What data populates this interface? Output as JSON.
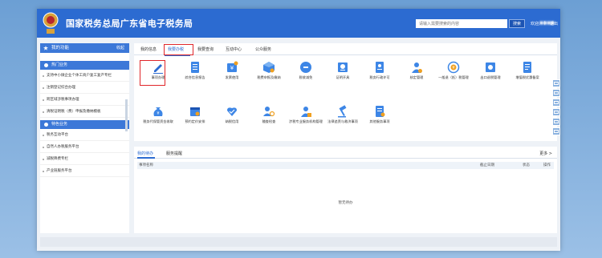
{
  "header": {
    "title": "国家税务总局广东省电子税务局",
    "search_placeholder": "请输入需要搜索的内容",
    "search_button": "搜索",
    "welcome": "欢迎,",
    "username": "■■■■",
    "separator": "|",
    "logout": "退出",
    "brand_color": "#2c6bd1"
  },
  "sidebar": {
    "header": "我的功能",
    "header_right": "收起",
    "sections": [
      {
        "title": "热门业务",
        "items": [
          "支持中小微企业个体工商户复工复产专栏",
          "注销登记综合办理",
          "跨区域涉税事项办理",
          "清税证明税（费）申报及缴纳模板"
        ]
      },
      {
        "title": "特色业务",
        "items": [
          "税务互动平台",
          "自然人办税服务平台",
          "减税降费专栏",
          "产业链服务平台"
        ]
      }
    ]
  },
  "tabs": [
    "我的信息",
    "我要办税",
    "我要查询",
    "互动中心",
    "公众服务"
  ],
  "services": [
    "事项办理",
    "综合信息报告",
    "发票使用",
    "税费申报及缴纳",
    "税收减免",
    "证明开具",
    "税务行政许可",
    "核定管理",
    "一般退（抵）税管理",
    "出口退税管理",
    "增值税优惠备案",
    "税务代保管资金收取",
    "预约定价安排",
    "纳税信用",
    "稽查检查",
    "涉税专业服务机构管理",
    "法律追责与救济事项",
    "其他服务事项"
  ],
  "todo": {
    "tabs": [
      "我的待办",
      "服务提醒"
    ],
    "more": "更多 >",
    "columns": [
      "事项名称",
      "截止日期",
      "状态",
      "操作"
    ],
    "empty": "暂无待办"
  }
}
